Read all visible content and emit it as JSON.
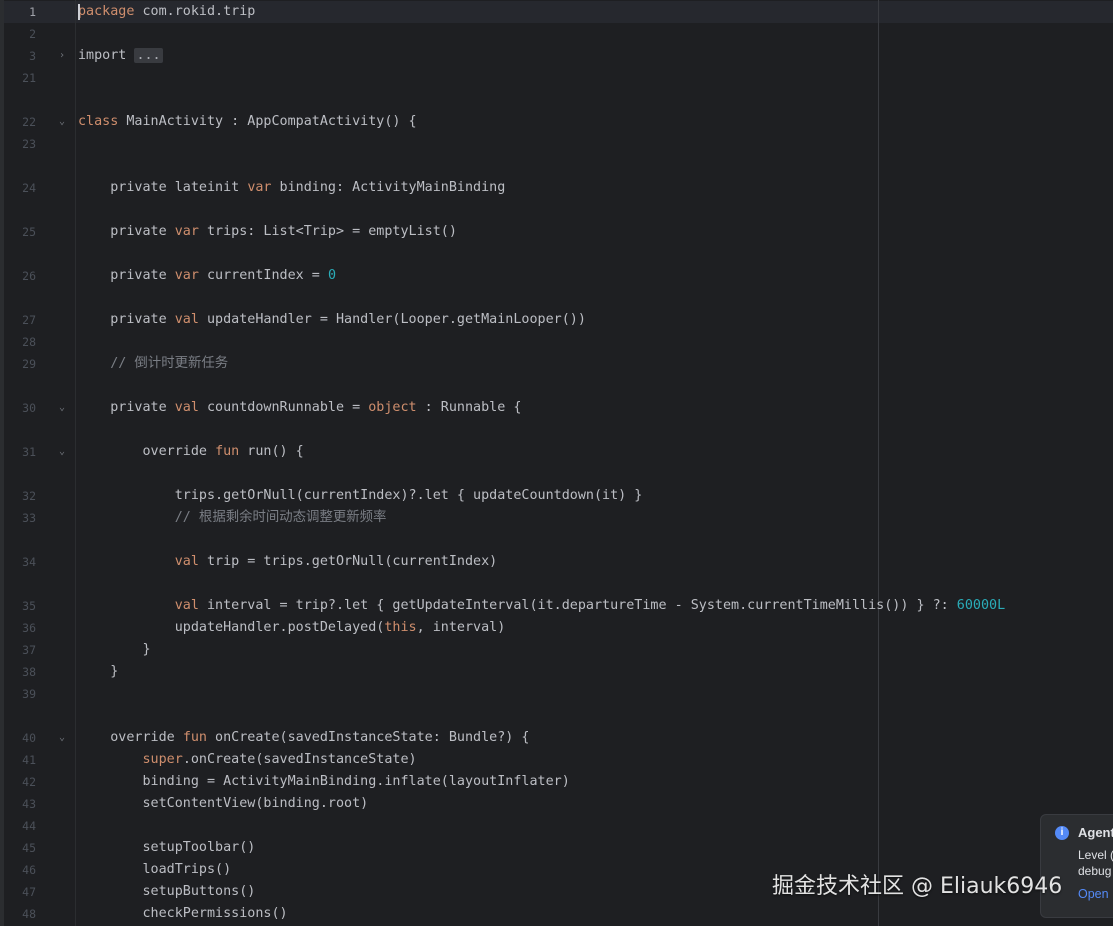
{
  "editor": {
    "lines": [
      {
        "num": "1",
        "fold": "",
        "tokens": [
          [
            "kw",
            "package"
          ],
          [
            "p",
            " com.rokid.trip"
          ]
        ]
      },
      {
        "num": "2",
        "fold": "",
        "tokens": []
      },
      {
        "num": "3",
        "fold": ">",
        "tokens": [
          [
            "p",
            "import "
          ],
          [
            "fold",
            "..."
          ]
        ]
      },
      {
        "num": "21",
        "fold": "",
        "tokens": []
      },
      {
        "num": "22",
        "fold": "v",
        "tokens": [
          [
            "kw",
            "class"
          ],
          [
            "p",
            " MainActivity : AppCompatActivity() {"
          ]
        ]
      },
      {
        "num": "23",
        "fold": "",
        "tokens": []
      },
      {
        "num": "24",
        "fold": "",
        "tokens": [
          [
            "p",
            "    private lateinit "
          ],
          [
            "kw",
            "var"
          ],
          [
            "p",
            " binding: ActivityMainBinding"
          ]
        ]
      },
      {
        "num": "25",
        "fold": "",
        "tokens": [
          [
            "p",
            "    private "
          ],
          [
            "kw",
            "var"
          ],
          [
            "p",
            " trips: List<Trip> = emptyList()"
          ]
        ]
      },
      {
        "num": "26",
        "fold": "",
        "tokens": [
          [
            "p",
            "    private "
          ],
          [
            "kw",
            "var"
          ],
          [
            "p",
            " currentIndex = "
          ],
          [
            "num",
            "0"
          ]
        ]
      },
      {
        "num": "27",
        "fold": "",
        "tokens": [
          [
            "p",
            "    private "
          ],
          [
            "kw",
            "val"
          ],
          [
            "p",
            " updateHandler = Handler(Looper.getMainLooper())"
          ]
        ]
      },
      {
        "num": "28",
        "fold": "",
        "tokens": []
      },
      {
        "num": "29",
        "fold": "",
        "tokens": [
          [
            "cm",
            "    // 倒计时更新任务"
          ]
        ]
      },
      {
        "num": "30",
        "fold": "v",
        "tokens": [
          [
            "p",
            "    private "
          ],
          [
            "kw",
            "val"
          ],
          [
            "p",
            " countdownRunnable = "
          ],
          [
            "kw",
            "object"
          ],
          [
            "p",
            " : Runnable {"
          ]
        ]
      },
      {
        "num": "31",
        "fold": "v",
        "tokens": [
          [
            "p",
            "        override "
          ],
          [
            "kw",
            "fun"
          ],
          [
            "p",
            " run() {"
          ]
        ]
      },
      {
        "num": "32",
        "fold": "",
        "tokens": [
          [
            "p",
            "            trips.getOrNull(currentIndex)?.let { updateCountdown(it) }"
          ]
        ]
      },
      {
        "num": "33",
        "fold": "",
        "tokens": [
          [
            "cm",
            "            // 根据剩余时间动态调整更新频率"
          ]
        ]
      },
      {
        "num": "34",
        "fold": "",
        "tokens": [
          [
            "p",
            "            "
          ],
          [
            "kw",
            "val"
          ],
          [
            "p",
            " trip = trips.getOrNull(currentIndex)"
          ]
        ]
      },
      {
        "num": "35",
        "fold": "",
        "tokens": [
          [
            "p",
            "            "
          ],
          [
            "kw",
            "val"
          ],
          [
            "p",
            " interval = trip?.let { getUpdateInterval(it.departureTime - System.currentTimeMillis()) } ?: "
          ],
          [
            "num",
            "60000L"
          ]
        ]
      },
      {
        "num": "36",
        "fold": "",
        "tokens": [
          [
            "p",
            "            updateHandler.postDelayed("
          ],
          [
            "kw",
            "this"
          ],
          [
            "p",
            ", interval)"
          ]
        ]
      },
      {
        "num": "37",
        "fold": "",
        "tokens": [
          [
            "p",
            "        }"
          ]
        ]
      },
      {
        "num": "38",
        "fold": "",
        "tokens": [
          [
            "p",
            "    }"
          ]
        ]
      },
      {
        "num": "39",
        "fold": "",
        "tokens": []
      },
      {
        "num": "40",
        "fold": "v",
        "tokens": [
          [
            "p",
            "    override "
          ],
          [
            "kw",
            "fun"
          ],
          [
            "p",
            " onCreate(savedInstanceState: Bundle?) {"
          ]
        ]
      },
      {
        "num": "41",
        "fold": "",
        "tokens": [
          [
            "p",
            "        "
          ],
          [
            "kw",
            "super"
          ],
          [
            "p",
            ".onCreate(savedInstanceState)"
          ]
        ]
      },
      {
        "num": "42",
        "fold": "",
        "tokens": [
          [
            "p",
            "        binding = ActivityMainBinding.inflate(layoutInflater)"
          ]
        ]
      },
      {
        "num": "43",
        "fold": "",
        "tokens": [
          [
            "p",
            "        setContentView(binding.root)"
          ]
        ]
      },
      {
        "num": "44",
        "fold": "",
        "tokens": []
      },
      {
        "num": "45",
        "fold": "",
        "tokens": [
          [
            "p",
            "        setupToolbar()"
          ]
        ]
      },
      {
        "num": "46",
        "fold": "",
        "tokens": [
          [
            "p",
            "        loadTrips()"
          ]
        ]
      },
      {
        "num": "47",
        "fold": "",
        "tokens": [
          [
            "p",
            "        setupButtons()"
          ]
        ]
      },
      {
        "num": "48",
        "fold": "",
        "tokens": [
          [
            "p",
            "        checkPermissions()"
          ]
        ]
      }
    ]
  },
  "notification": {
    "title": "Agent",
    "body_line1": "Level (",
    "body_line2": "debug",
    "link": "Open"
  },
  "watermark": {
    "text": "掘金技术社区 @ Eliauk6946"
  },
  "colors": {
    "background": "#1e1f22",
    "keyword": "#cf8e6d",
    "number": "#2aacb8",
    "comment": "#7a7e85",
    "text": "#bcbec4"
  }
}
